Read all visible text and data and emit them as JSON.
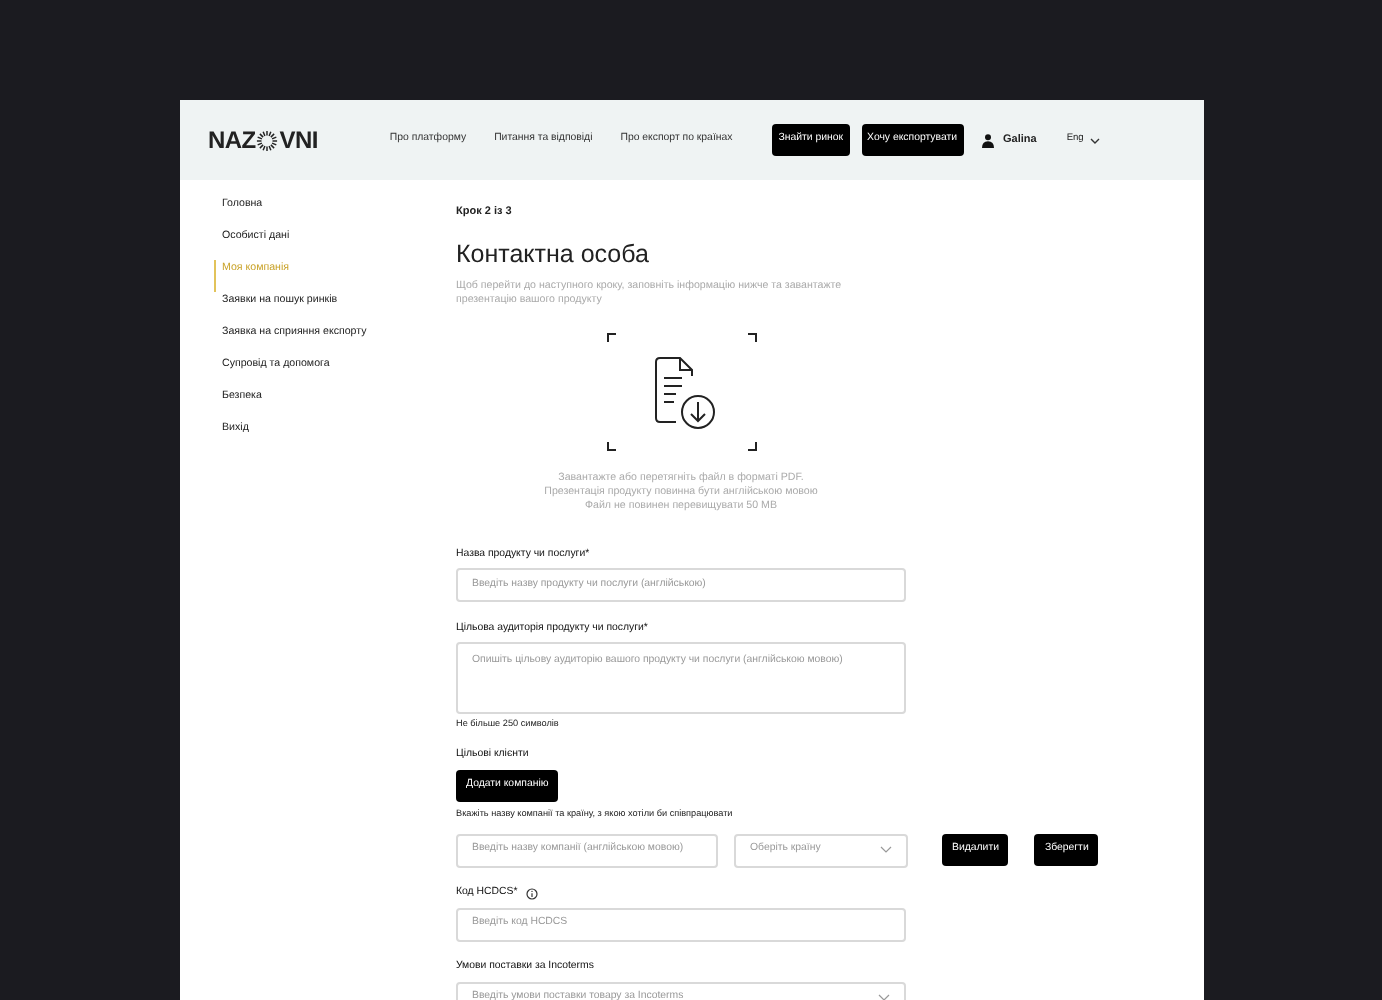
{
  "header": {
    "logo_start": "NAZ",
    "logo_end": "VNI",
    "nav": [
      "Про платформу",
      "Питання та відповіді",
      "Про експорт по країнах"
    ],
    "buttons": [
      "Знайти ринок",
      "Хочу експортувати"
    ],
    "user": "Galina",
    "language": "Eng"
  },
  "sidebar": {
    "items": [
      {
        "label": "Головна",
        "selected": false
      },
      {
        "label": "Особисті дані",
        "selected": false
      },
      {
        "label": "Моя компанія",
        "selected": true
      },
      {
        "label": "Заявки на пошук ринків",
        "selected": false
      },
      {
        "label": "Заявка на сприяння експорту",
        "selected": false
      },
      {
        "label": "Супровід та допомога",
        "selected": false
      },
      {
        "label": "Безпека",
        "selected": false
      },
      {
        "label": "Вихід",
        "selected": false
      }
    ]
  },
  "step": "Крок 2 із 3",
  "title": "Контактна особа",
  "subtitle": "Щоб перейти до наступного кроку, заповніть інформацію нижче та завантажте презентацію вашого продукту",
  "upload": {
    "lines": [
      "Завантажте або перетягніть файл в форматі PDF.",
      "Презентація продукту повинна бути англійською мовою",
      "Файл не повинен перевищувати 50 MB"
    ]
  },
  "fields": [
    {
      "kind": "input",
      "label": "Назва продукту чи послуги*",
      "placeholder": "Введіть назву продукту чи послуги (англійською)"
    },
    {
      "kind": "textarea",
      "label": "Цільова аудиторія продукту чи послуги*",
      "placeholder": "Опишіть цільову аудиторію вашого продукту чи послуги (англійською мовою)",
      "hint": "Не більше 250 символів"
    },
    {
      "kind": "clients",
      "label": "Цільові клієнти",
      "button": "Додати компанію",
      "hint": "Вкажіть назву компанії та країну, з якою хотіли би співпрацювати",
      "company_placeholder": "Введіть назву компанії (англійською мовою)",
      "country_placeholder": "Оберіть країну",
      "actions": [
        "Видалити",
        "Зберегти"
      ]
    },
    {
      "kind": "input",
      "label": "Код HCDCS*",
      "info": true,
      "placeholder": "Введіть код HCDCS"
    },
    {
      "kind": "select",
      "label": "Умови поставки за Incoterms",
      "placeholder": "Введіть умови поставки товару за Incoterms"
    }
  ]
}
